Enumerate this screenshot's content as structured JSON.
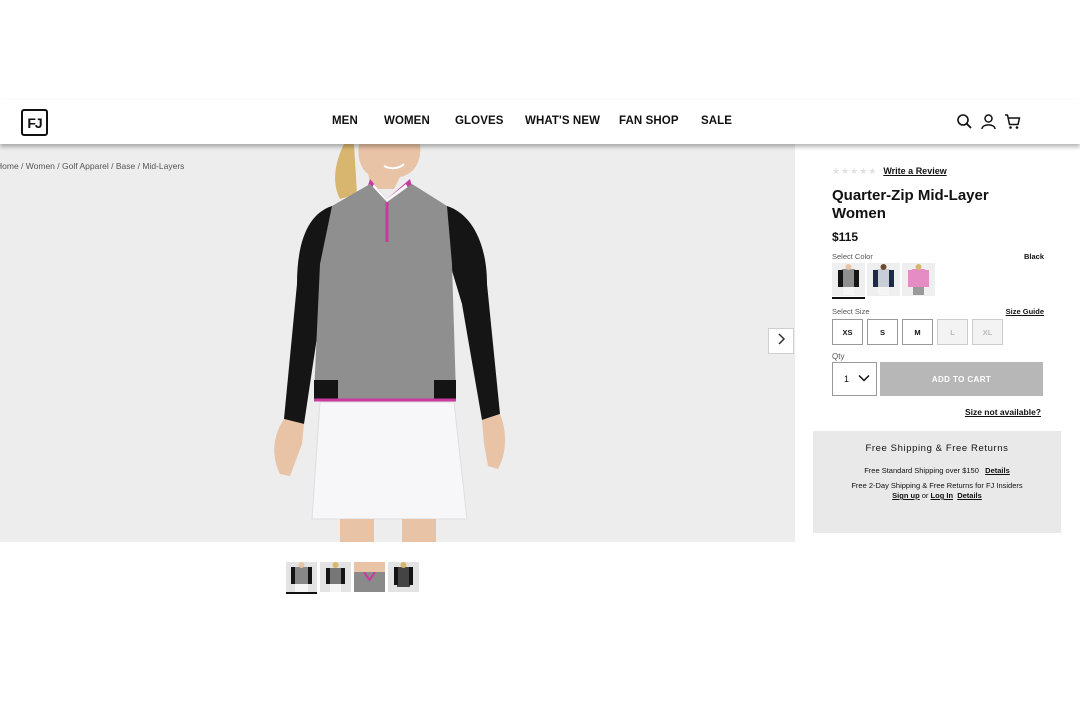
{
  "header": {
    "logo_text": "FJ",
    "nav": [
      "MEN",
      "WOMEN",
      "GLOVES",
      "WHAT'S NEW",
      "FAN SHOP",
      "SALE"
    ],
    "icons": [
      "search-icon",
      "account-icon",
      "cart-icon"
    ]
  },
  "breadcrumb": {
    "items": [
      "Home",
      "Women",
      "Golf Apparel",
      "Base",
      "Mid-Layers"
    ],
    "separator": " / "
  },
  "product": {
    "rating_stars": "★★★★★",
    "review_link": "Write a Review",
    "title_line1": "Quarter-Zip Mid-Layer",
    "title_line2": "Women",
    "price": "$115",
    "select_color_label": "Select Color",
    "selected_color": "Black",
    "select_size_label": "Select Size",
    "size_guide": "Size Guide",
    "sizes": [
      {
        "label": "XS",
        "available": true
      },
      {
        "label": "S",
        "available": true
      },
      {
        "label": "M",
        "available": true
      },
      {
        "label": "L",
        "available": false
      },
      {
        "label": "XL",
        "available": false
      }
    ],
    "qty_label": "Qty",
    "qty_value": "1",
    "add_to_cart": "ADD TO CART",
    "size_not_available": "Size not available?"
  },
  "shipping": {
    "title": "Free Shipping & Free Returns",
    "line1_text": "Free Standard Shipping over $150",
    "line1_link": "Details",
    "line2_text": "Free 2-Day Shipping & Free Returns for FJ Insiders",
    "sign_up": "Sign up",
    "or": "or",
    "log_in": "Log In",
    "details": "Details"
  },
  "colors": {
    "accent_pink": "#d44fb4",
    "button_disabled": "#b7b7b7",
    "hero_bg": "#ededed"
  }
}
